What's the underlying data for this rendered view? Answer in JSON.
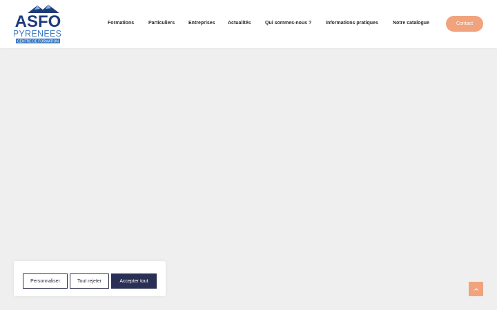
{
  "logo": {
    "main_text": "ASFO",
    "sub_text": "PYRENEES",
    "banner_text": "CENTRE DE FORMATION",
    "colors": {
      "navy": "#1f3c7a",
      "blue": "#3a78c2",
      "mountain": "#7fb2e5"
    }
  },
  "nav": {
    "items": [
      {
        "label": "Formations"
      },
      {
        "label": "Particuliers"
      },
      {
        "label": "Entreprises"
      },
      {
        "label": "Actualités"
      },
      {
        "label": "Qui sommes-nous ?"
      },
      {
        "label": "Informations pratiques"
      },
      {
        "label": "Notre catalogue"
      }
    ]
  },
  "header": {
    "contact_label": "Contact",
    "accent_color": "#f0a37c"
  },
  "cookie": {
    "customize_label": "Personnaliser",
    "reject_label": "Tout rejeter",
    "accept_label": "Accepter tout"
  },
  "back_to_top": {
    "icon": "chevron-up-icon"
  }
}
